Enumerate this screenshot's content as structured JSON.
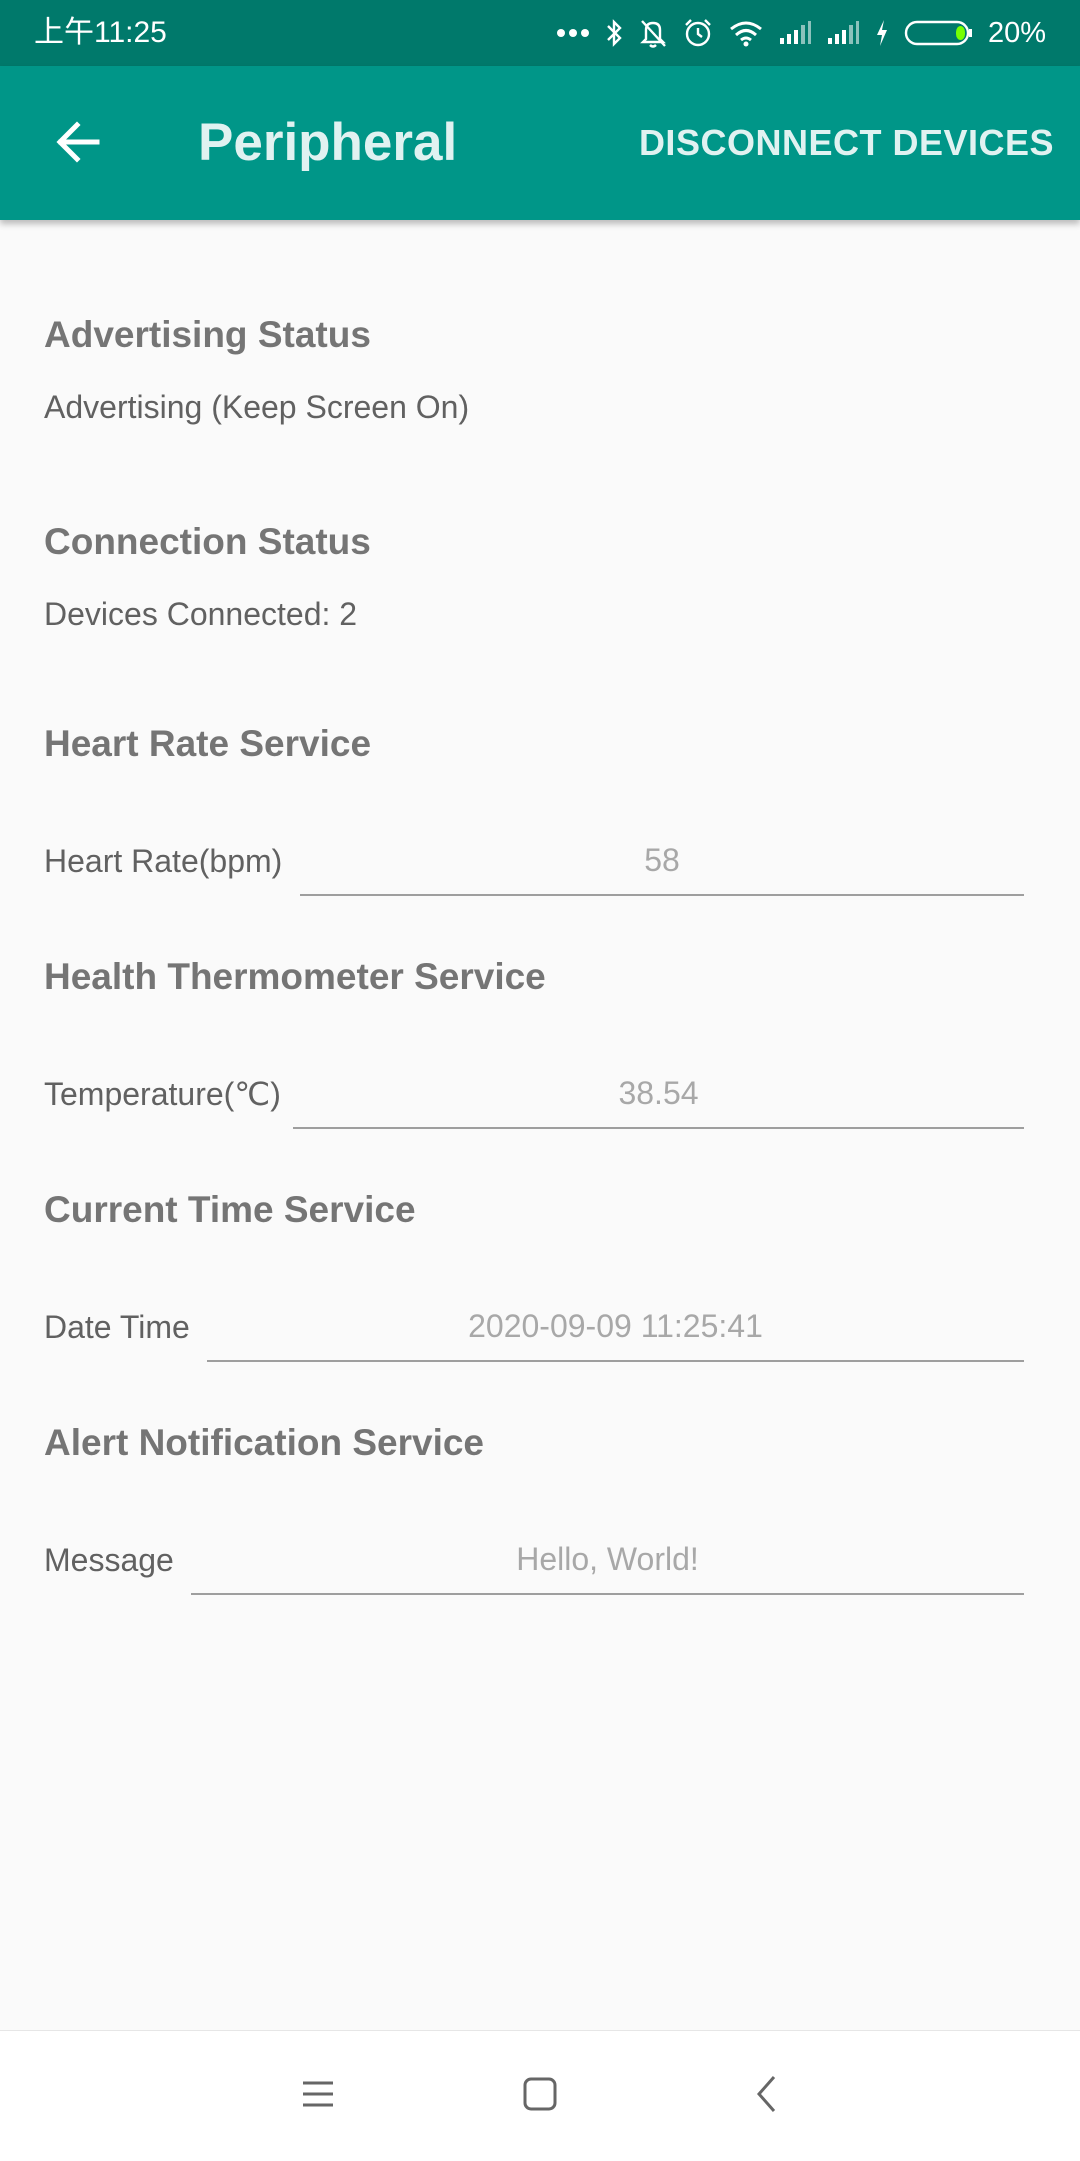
{
  "status_bar": {
    "time": "上午11:25",
    "battery": "20%"
  },
  "app_bar": {
    "title": "Peripheral",
    "action_label": "DISCONNECT DEVICES",
    "color": "#009688"
  },
  "advertising": {
    "title": "Advertising Status",
    "value": "Advertising (Keep Screen On)"
  },
  "connection": {
    "title": "Connection Status",
    "value": "Devices Connected: 2"
  },
  "heart_rate": {
    "title": "Heart Rate Service",
    "label": "Heart Rate(bpm)",
    "value": "58"
  },
  "thermometer": {
    "title": "Health Thermometer Service",
    "label": "Temperature(℃)",
    "value": "38.54"
  },
  "current_time": {
    "title": "Current Time Service",
    "label": "Date Time",
    "value": "2020-09-09 11:25:41"
  },
  "alert": {
    "title": "Alert Notification Service",
    "label": "Message",
    "value": "Hello, World!"
  }
}
